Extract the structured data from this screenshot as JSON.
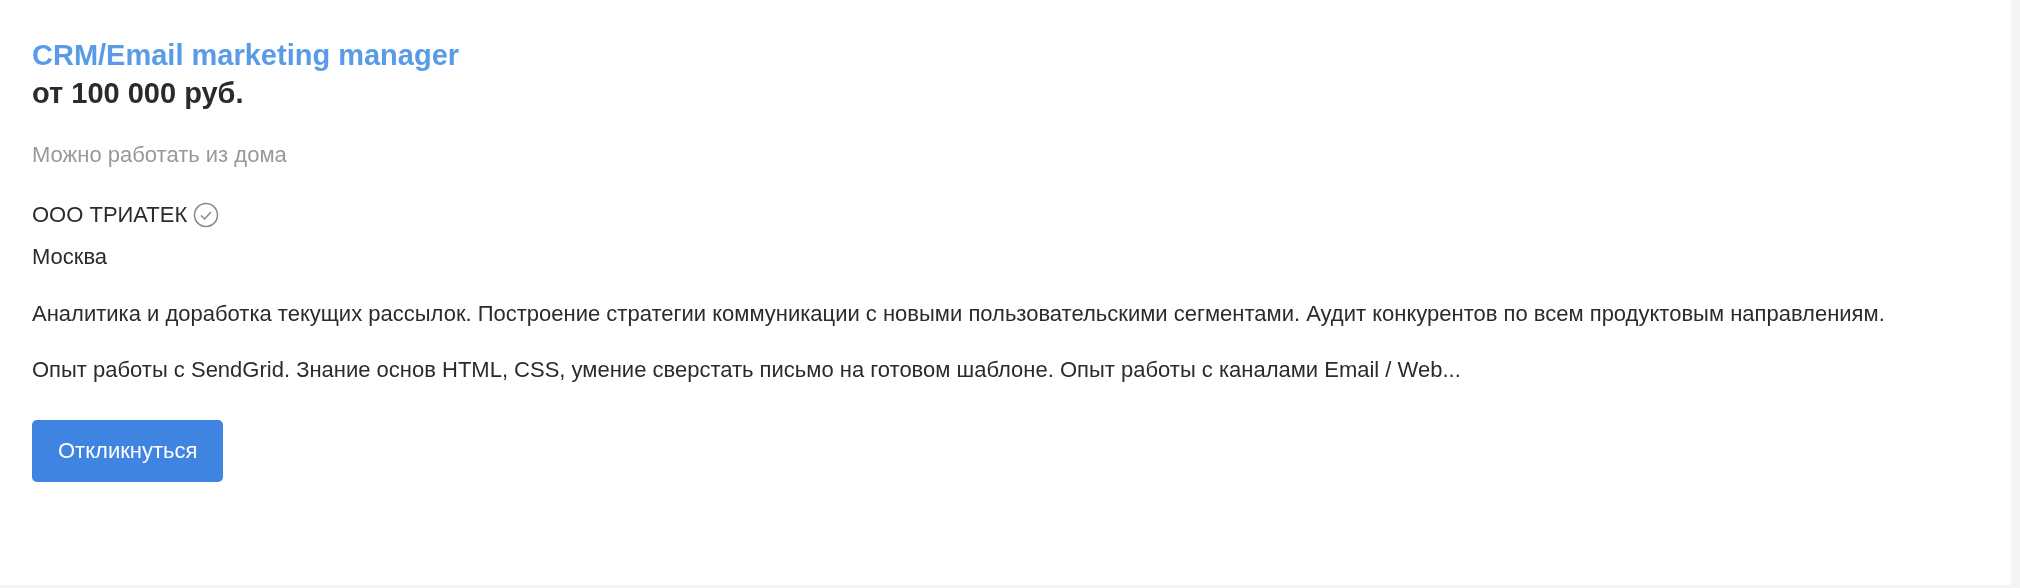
{
  "vacancy": {
    "title": "CRM/Email marketing manager",
    "salary": "от 100 000 руб.",
    "remote_note": "Можно работать из дома",
    "company": {
      "name": "ООО ТРИАТЕК",
      "verified": true
    },
    "city": "Москва",
    "descriptions": [
      "Аналитика и доработка текущих рассылок. Построение стратегии коммуникации с новыми пользовательскими сегментами. Аудит конкурентов по всем продуктовым направлениям.",
      "Опыт работы с SendGrid. Знание основ HTML, CSS, умение сверстать письмо на готовом шаблоне. Опыт работы с каналами Email / Web..."
    ],
    "respond_button": "Откликнуться"
  }
}
